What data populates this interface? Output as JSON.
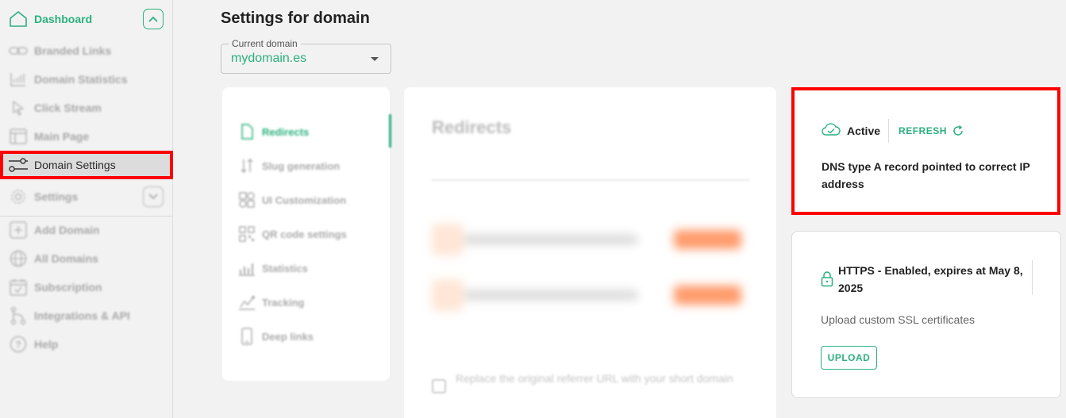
{
  "sidebar": {
    "items": [
      {
        "label": "Dashboard",
        "icon": "home-icon"
      },
      {
        "label": "Branded Links",
        "icon": "link-icon"
      },
      {
        "label": "Domain Statistics",
        "icon": "chart-icon"
      },
      {
        "label": "Click Stream",
        "icon": "cursor-icon"
      },
      {
        "label": "Main Page",
        "icon": "layout-icon"
      },
      {
        "label": "Domain Settings",
        "icon": "sliders-icon"
      },
      {
        "label": "Settings",
        "icon": "gear-icon"
      },
      {
        "label": "Add Domain",
        "icon": "plus-square-icon"
      },
      {
        "label": "All Domains",
        "icon": "globe-icon"
      },
      {
        "label": "Subscription",
        "icon": "calendar-check-icon"
      },
      {
        "label": "Integrations & API",
        "icon": "git-branch-icon"
      },
      {
        "label": "Help",
        "icon": "help-circle-icon"
      }
    ]
  },
  "page": {
    "title": "Settings for domain"
  },
  "domain_select": {
    "label": "Current domain",
    "value": "mydomain.es"
  },
  "tabs": [
    {
      "label": "Redirects",
      "icon": "file-icon"
    },
    {
      "label": "Slug generation",
      "icon": "sort-icon"
    },
    {
      "label": "UI Customization",
      "icon": "palette-icon"
    },
    {
      "label": "QR code settings",
      "icon": "qr-code-icon"
    },
    {
      "label": "Statistics",
      "icon": "stats-icon"
    },
    {
      "label": "Tracking",
      "icon": "tracking-icon"
    },
    {
      "label": "Deep links",
      "icon": "phone-icon"
    }
  ],
  "redirects": {
    "title": "Redirects",
    "checkbox_label": "Replace the original referrer URL with your short domain"
  },
  "status": {
    "state": "Active",
    "refresh_label": "REFRESH",
    "description": "DNS type A record pointed to correct IP address"
  },
  "https": {
    "status_text": "HTTPS - Enabled, expires at May 8, 2025",
    "subtitle": "Upload custom SSL certificates",
    "upload_label": "UPLOAD"
  },
  "colors": {
    "accent": "#2bb07e",
    "highlight": "#ff0000",
    "background": "#f2f2f2"
  }
}
